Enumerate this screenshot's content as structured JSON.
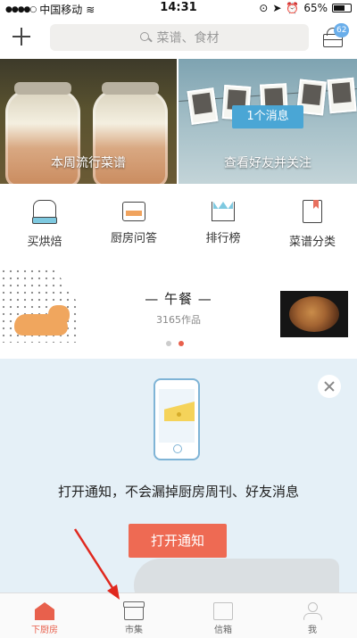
{
  "status_bar": {
    "carrier": "中国移动",
    "time": "14:31",
    "battery": "65%",
    "battery_level": 0.65
  },
  "header": {
    "search_placeholder": "菜谱、食材",
    "cart_badge": "62"
  },
  "banners": [
    {
      "caption": "本周流行菜谱"
    },
    {
      "caption": "查看好友并关注",
      "pill": "1个消息"
    }
  ],
  "categories": [
    {
      "label": "买烘焙",
      "icon": "oven-mitt-icon"
    },
    {
      "label": "厨房问答",
      "icon": "cooking-pot-icon"
    },
    {
      "label": "排行榜",
      "icon": "crown-icon"
    },
    {
      "label": "菜谱分类",
      "icon": "bookmark-book-icon"
    }
  ],
  "meal": {
    "title": "— 午餐 —",
    "count": "3165作品"
  },
  "notification": {
    "text": "打开通知，不会漏掉厨房周刊、好友消息",
    "button": "打开通知"
  },
  "tabs": [
    {
      "label": "下厨房",
      "icon": "home-icon",
      "active": true
    },
    {
      "label": "市集",
      "icon": "store-icon",
      "active": false
    },
    {
      "label": "信箱",
      "icon": "mail-icon",
      "active": false
    },
    {
      "label": "我",
      "icon": "profile-icon",
      "active": false
    }
  ],
  "colors": {
    "accent": "#e8604c",
    "badge": "#6aaeea",
    "notify_bg": "#e5f0f7"
  }
}
